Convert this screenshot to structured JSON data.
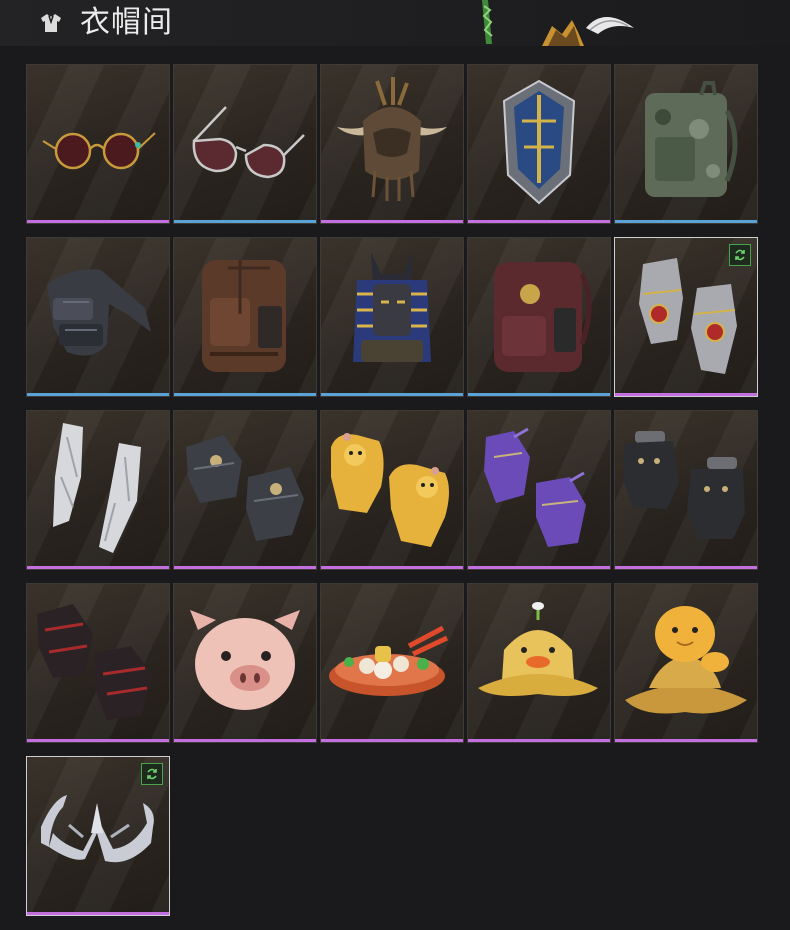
{
  "header": {
    "title": "衣帽间",
    "icon": "wardrobe-shirt-icon"
  },
  "colors": {
    "rarity_purple": "#c46fe0",
    "rarity_blue": "#5ba3d6",
    "badge_green": "#49a34a"
  },
  "items": [
    {
      "name": "round-sunglasses",
      "rarity": "purple",
      "badge": false
    },
    {
      "name": "aviator-sunglasses",
      "rarity": "blue",
      "badge": false
    },
    {
      "name": "horned-feather-helmet",
      "rarity": "purple",
      "badge": false
    },
    {
      "name": "knight-shield-helmet",
      "rarity": "purple",
      "badge": false
    },
    {
      "name": "camo-backpack",
      "rarity": "blue",
      "badge": false
    },
    {
      "name": "tactical-chest-rig",
      "rarity": "blue",
      "badge": false
    },
    {
      "name": "brown-backpack",
      "rarity": "blue",
      "badge": false
    },
    {
      "name": "anubis-backpack",
      "rarity": "blue",
      "badge": false
    },
    {
      "name": "crimson-backpack",
      "rarity": "blue",
      "badge": false
    },
    {
      "name": "jeweled-gauntlets",
      "rarity": "purple",
      "badge": true
    },
    {
      "name": "crystal-gauntlets",
      "rarity": "purple",
      "badge": false
    },
    {
      "name": "armored-gloves",
      "rarity": "purple",
      "badge": false
    },
    {
      "name": "chick-gloves",
      "rarity": "purple",
      "badge": false
    },
    {
      "name": "violet-gloves",
      "rarity": "purple",
      "badge": false
    },
    {
      "name": "studded-black-gloves",
      "rarity": "purple",
      "badge": false
    },
    {
      "name": "red-black-gloves",
      "rarity": "purple",
      "badge": false
    },
    {
      "name": "pig-mask",
      "rarity": "purple",
      "badge": false
    },
    {
      "name": "food-platter-hat",
      "rarity": "purple",
      "badge": false
    },
    {
      "name": "duck-bucket-hat",
      "rarity": "purple",
      "badge": false
    },
    {
      "name": "dino-bucket-hat",
      "rarity": "purple",
      "badge": false
    },
    {
      "name": "silver-thorn-tiara",
      "rarity": "purple",
      "badge": true
    }
  ]
}
